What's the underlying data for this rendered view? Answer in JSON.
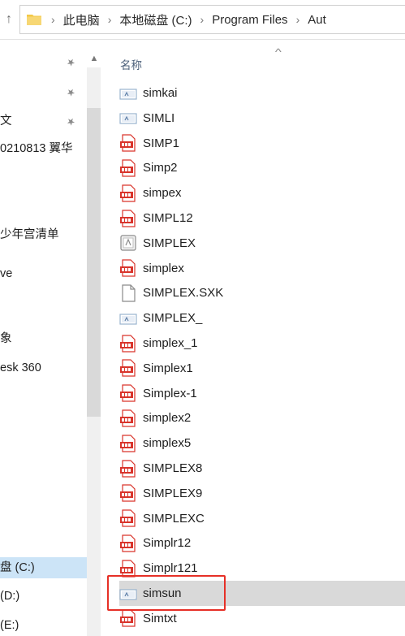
{
  "address_bar": {
    "up_glyph": "↑",
    "breadcrumbs": [
      "此电脑",
      "本地磁盘 (C:)",
      "Program Files",
      "Aut"
    ]
  },
  "nav_pane": {
    "items": [
      {
        "label": "",
        "pinned": true
      },
      {
        "label": "",
        "pinned": true
      },
      {
        "label": "文",
        "pinned": true
      },
      {
        "label": "0210813 翼华",
        "pinned": false
      },
      {
        "label": "少年宫清单",
        "pinned": false
      },
      {
        "label": "ve",
        "pinned": false
      },
      {
        "label": "象",
        "pinned": false
      },
      {
        "label": "esk 360",
        "pinned": false
      },
      {
        "label": "盘 (C:)",
        "pinned": false,
        "selected": true
      },
      {
        "label": " (D:)",
        "pinned": false
      },
      {
        "label": " (E:)",
        "pinned": false
      }
    ]
  },
  "file_list": {
    "column_header": "名称",
    "sort_glyph": "^",
    "files": [
      {
        "name": "simkai",
        "icon": "generic-file-icon"
      },
      {
        "name": "SIMLI",
        "icon": "generic-file-icon"
      },
      {
        "name": "SIMP1",
        "icon": "shx-file-icon"
      },
      {
        "name": "Simp2",
        "icon": "shx-file-icon"
      },
      {
        "name": "simpex",
        "icon": "shx-file-icon"
      },
      {
        "name": "SIMPL12",
        "icon": "shx-file-icon"
      },
      {
        "name": "SIMPLEX",
        "icon": "font-file-icon"
      },
      {
        "name": "simplex",
        "icon": "shx-file-icon"
      },
      {
        "name": "SIMPLEX.SXK",
        "icon": "blank-file-icon"
      },
      {
        "name": "SIMPLEX_",
        "icon": "generic-file-icon"
      },
      {
        "name": "simplex_1",
        "icon": "shx-file-icon"
      },
      {
        "name": "Simplex1",
        "icon": "shx-file-icon"
      },
      {
        "name": "Simplex-1",
        "icon": "shx-file-icon"
      },
      {
        "name": "simplex2",
        "icon": "shx-file-icon"
      },
      {
        "name": "simplex5",
        "icon": "shx-file-icon"
      },
      {
        "name": "SIMPLEX8",
        "icon": "shx-file-icon"
      },
      {
        "name": "SIMPLEX9",
        "icon": "shx-file-icon"
      },
      {
        "name": "SIMPLEXC",
        "icon": "shx-file-icon"
      },
      {
        "name": "Simplr12",
        "icon": "shx-file-icon"
      },
      {
        "name": "Simplr121",
        "icon": "shx-file-icon"
      },
      {
        "name": "simsun",
        "icon": "generic-file-icon",
        "selected": true
      },
      {
        "name": "Simtxt",
        "icon": "shx-file-icon"
      }
    ]
  },
  "colors": {
    "shx_red": "#d9342b",
    "selection_gray": "#d9d9d9",
    "nav_selected_blue": "#cce4f7",
    "highlight_box": "#e63027",
    "folder_yellow": "#f3c846"
  }
}
